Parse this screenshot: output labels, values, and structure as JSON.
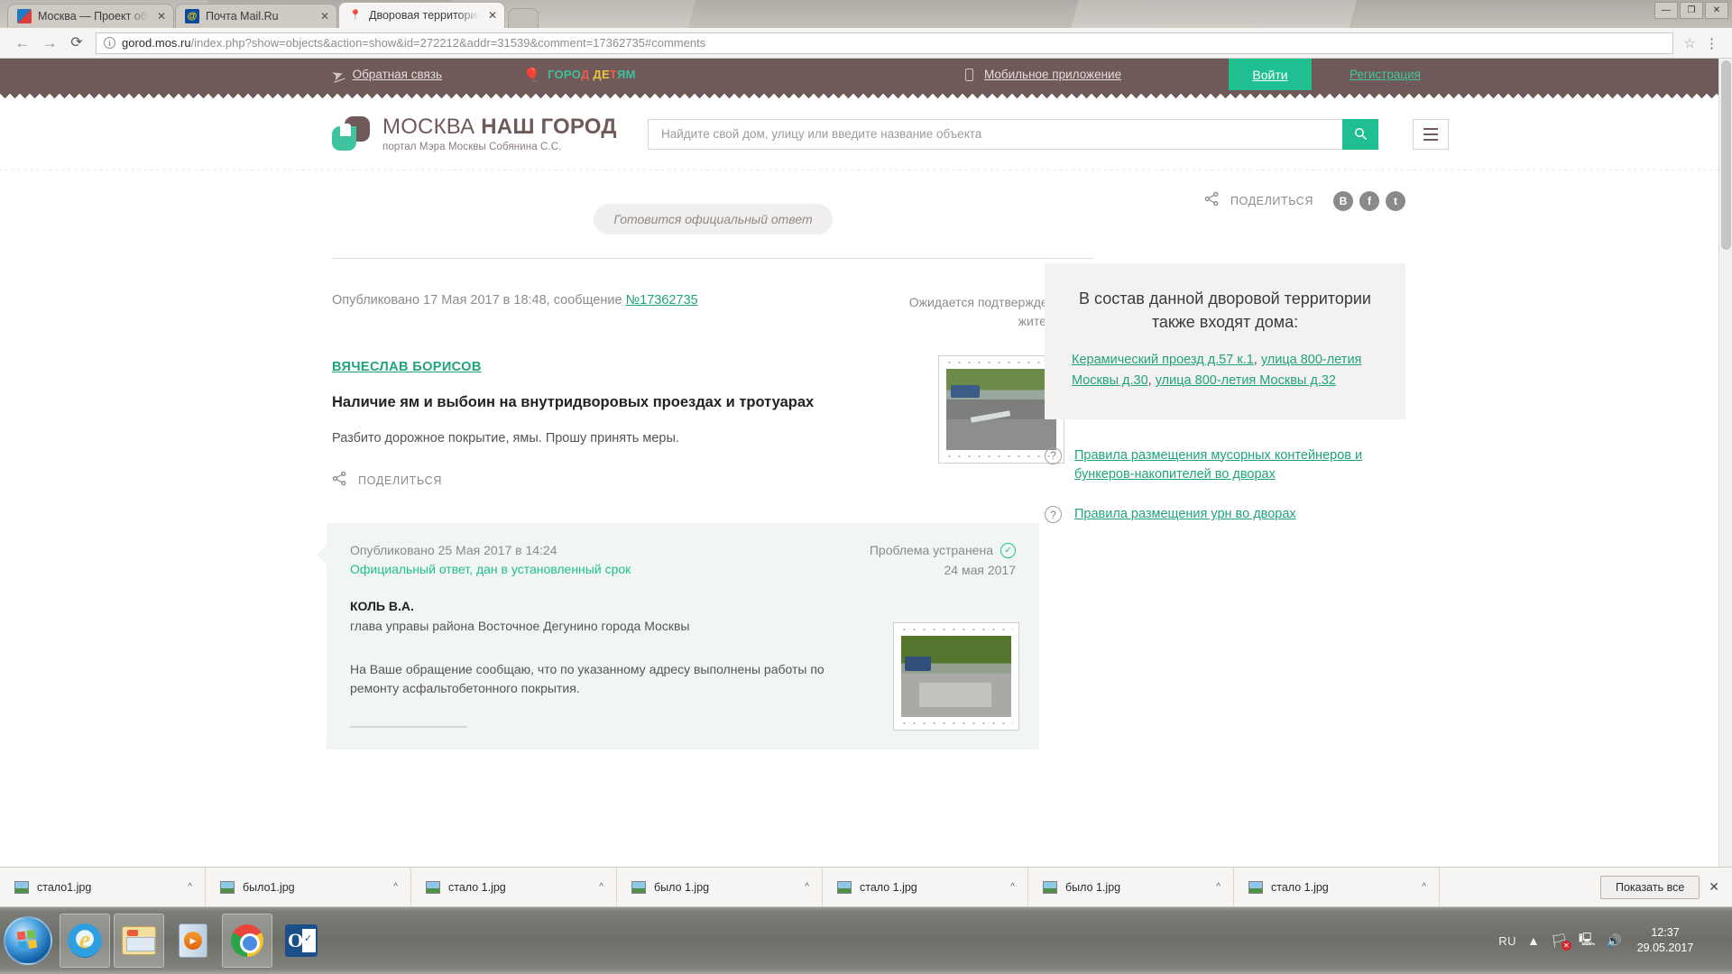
{
  "browser": {
    "tabs": [
      {
        "title": "Москва — Проект обще",
        "favicon": "moscow-icon",
        "active": false
      },
      {
        "title": "Почта Mail.Ru",
        "favicon": "mailru-icon",
        "active": false
      },
      {
        "title": "Дворовая территория п",
        "favicon": "map-pin-icon",
        "active": true
      }
    ],
    "window_controls": [
      "—",
      "❐",
      "✕"
    ],
    "nav": {
      "back": "←",
      "forward": "→",
      "reload": "⟳"
    },
    "url_domain": "gorod.mos.ru",
    "url_path": "/index.php?show=objects&action=show&id=272212&addr=31539&comment=17362735#comments",
    "bookmark_star": "☆",
    "menu": "⋮"
  },
  "topbar": {
    "feedback": "Обратная связь",
    "kids_parts": [
      {
        "t": "ГОРО",
        "c": "green"
      },
      {
        "t": "Д",
        "c": "red"
      },
      {
        "t": " ДЕ",
        "c": "yellow"
      },
      {
        "t": "Т",
        "c": "red"
      },
      {
        "t": "ЯМ",
        "c": "green"
      }
    ],
    "kids_full": "ГОРОД ДЕТЯМ",
    "mobile_app": "Мобильное приложение",
    "login": "Войти",
    "register": "Регистрация",
    "accent_green": "#1fbf92",
    "bar_brown": "#6f5a59"
  },
  "site_header": {
    "logo_line1_light": "МОСКВА ",
    "logo_line1_bold": "НАШ ГОРОД",
    "logo_line2": "портал Мэра Москвы Собянина С.С.",
    "search_placeholder": "Найдите свой дом, улицу или введите название объекта",
    "search_value": "",
    "search_button_icon": "search-icon",
    "menu_button_icon": "hamburger-icon"
  },
  "main": {
    "status_pill": "Готовится официальный ответ",
    "share_label": "ПОДЕЛИТЬСЯ",
    "socials": [
      "В",
      "f",
      "t"
    ],
    "post": {
      "published": "Опубликовано 17 Мая 2017 в 18:48, сообщение ",
      "message_no": "№17362735",
      "await_status": "Ожидается подтверждение жителем",
      "author": "ВЯЧЕСЛАВ БОРИСОВ",
      "title": "Наличие ям и выбоин на внутридворовых проездах и тротуарах",
      "body": "Разбито дорожное покрытие, ямы. Прошу принять меры.",
      "share_label": "ПОДЕЛИТЬСЯ",
      "photo_alt": "photo-road-before"
    },
    "answer": {
      "published": "Опубликовано 25 Мая 2017 в 14:24",
      "official_note": "Официальный ответ, дан в установленный срок",
      "status": "Проблема устранена",
      "status_date": "24 мая 2017",
      "name": "КОЛЬ В.А.",
      "role": "глава управы района Восточное Дегунино города Москвы",
      "text": "На Ваше обращение сообщаю, что по указанному адресу выполнены работы по ремонту асфальтобетонного покрытия.",
      "photo_alt": "photo-road-after"
    }
  },
  "sidebar": {
    "card_title": "В состав данной дворовой территории также входят дома:",
    "addresses": [
      {
        "label": "Керамический проезд д.57 к.1",
        "sep": ", "
      },
      {
        "label": "улица 800-летия Москвы д.30",
        "sep": ", "
      },
      {
        "label": "улица 800-летия Москвы д.32",
        "sep": ""
      }
    ],
    "rules": [
      "Правила размещения мусорных контейнеров и бункеров-накопителей во дворах",
      "Правила размещения урн во дворах"
    ]
  },
  "download_bar": {
    "items": [
      "стало1.jpg",
      "было1.jpg",
      "стало 1.jpg",
      "было 1.jpg",
      "стало 1.jpg",
      "было 1.jpg",
      "стало 1.jpg"
    ],
    "caret": "^",
    "show_all": "Показать все",
    "close": "✕"
  },
  "taskbar": {
    "apps": [
      "internet-explorer",
      "file-explorer",
      "windows-media-player",
      "google-chrome",
      "microsoft-outlook"
    ],
    "language": "RU",
    "time": "12:37",
    "date": "29.05.2017"
  }
}
